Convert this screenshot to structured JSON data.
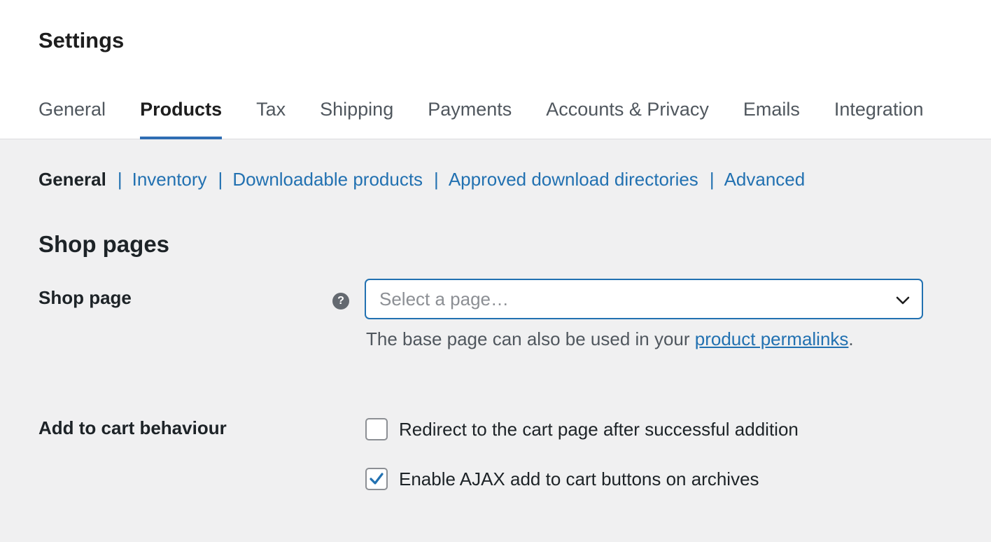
{
  "page": {
    "title": "Settings"
  },
  "tabs": [
    {
      "label": "General",
      "active": false
    },
    {
      "label": "Products",
      "active": true
    },
    {
      "label": "Tax",
      "active": false
    },
    {
      "label": "Shipping",
      "active": false
    },
    {
      "label": "Payments",
      "active": false
    },
    {
      "label": "Accounts & Privacy",
      "active": false
    },
    {
      "label": "Emails",
      "active": false
    },
    {
      "label": "Integration",
      "active": false
    }
  ],
  "subnav": {
    "current": "General",
    "separator": "|",
    "links": [
      "Inventory",
      "Downloadable products",
      "Approved download directories",
      "Advanced"
    ]
  },
  "section": {
    "title": "Shop pages"
  },
  "shop_page": {
    "label": "Shop page",
    "help_icon": "?",
    "select_placeholder": "Select a page…",
    "description_prefix": "The base page can also be used in your ",
    "description_link": "product permalinks",
    "description_suffix": "."
  },
  "cart_behaviour": {
    "label": "Add to cart behaviour",
    "options": [
      {
        "label": "Redirect to the cart page after successful addition",
        "checked": false
      },
      {
        "label": "Enable AJAX add to cart buttons on archives",
        "checked": true
      }
    ]
  },
  "colors": {
    "accent": "#2271b1",
    "active_tab_underline": "#2f6db3",
    "background": "#f0f0f1"
  },
  "icons": {
    "help": "help-icon",
    "select_chevron": "chevron-down-icon",
    "checkmark": "checkmark-icon"
  }
}
